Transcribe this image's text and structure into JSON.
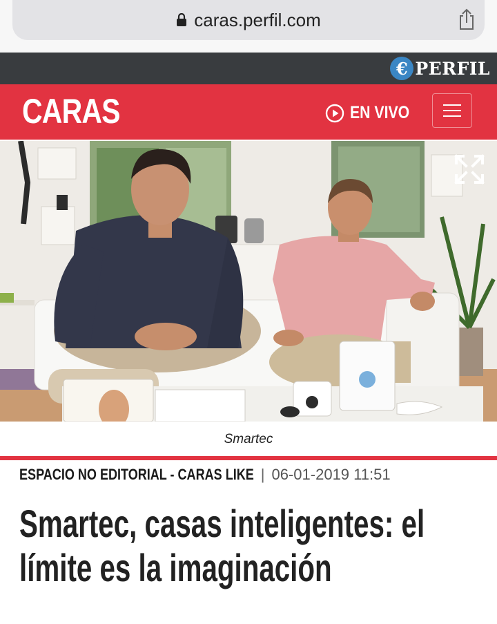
{
  "browser": {
    "url": "caras.perfil.com"
  },
  "network": {
    "brand": "PERFIL",
    "brand_initial": "€"
  },
  "header": {
    "logo": "CARAS",
    "live_label": "EN VIVO"
  },
  "hero": {
    "caption": "Smartec"
  },
  "article": {
    "section": "ESPACIO NO EDITORIAL - CARAS LIKE",
    "date": "06-01-2019 11:51",
    "title": "Smartec, casas inteligentes: el límite es la imaginación"
  },
  "colors": {
    "accent": "#e23341",
    "dark_strip": "#393c3f",
    "perfil_blue": "#3a86c4"
  },
  "icons": [
    "lock-icon",
    "share-icon",
    "play-circle-icon",
    "hamburger-menu-icon",
    "expand-icon"
  ]
}
